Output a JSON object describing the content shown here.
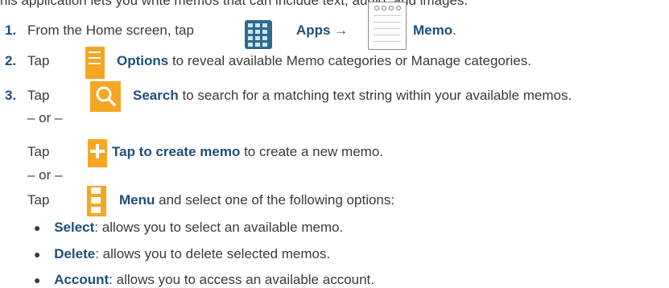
{
  "intro": "his application lets you write memos that can include text, audio, and images.",
  "steps": {
    "s1": {
      "num": "1.",
      "text_a": "From the Home screen, tap",
      "apps": "Apps",
      "arrow": "→",
      "memo": "Memo",
      "end": "."
    },
    "s2": {
      "num": "2.",
      "tap": "Tap",
      "options": "Options",
      "rest": "to reveal available Memo categories or Manage categories."
    },
    "s3": {
      "num": "3.",
      "tap": "Tap",
      "search": "Search",
      "rest": "to search for a matching text string within your available memos."
    },
    "or1": "– or –",
    "create": {
      "tap": "Tap",
      "label": "Tap to create memo",
      "rest": "to create a new memo."
    },
    "or2": "– or –",
    "menu": {
      "tap": "Tap",
      "label": "Menu",
      "rest": "and select one of the following options:"
    }
  },
  "options": [
    {
      "label": "Select",
      "desc": ": allows you to select an available memo."
    },
    {
      "label": "Delete",
      "desc": ": allows you to delete selected memos."
    },
    {
      "label": "Account",
      "desc": ": allows you to access an available account."
    }
  ],
  "icons": {
    "apps": "apps-grid-icon",
    "memo": "memo-notepad-icon",
    "options": "options-list-icon",
    "search": "search-icon",
    "create": "plus-icon",
    "menu": "menu-icon"
  },
  "colors": {
    "accent": "#1f4e79",
    "orange": "#f5a623",
    "apps": "#2e6a8f",
    "text": "#3a3a3a"
  }
}
